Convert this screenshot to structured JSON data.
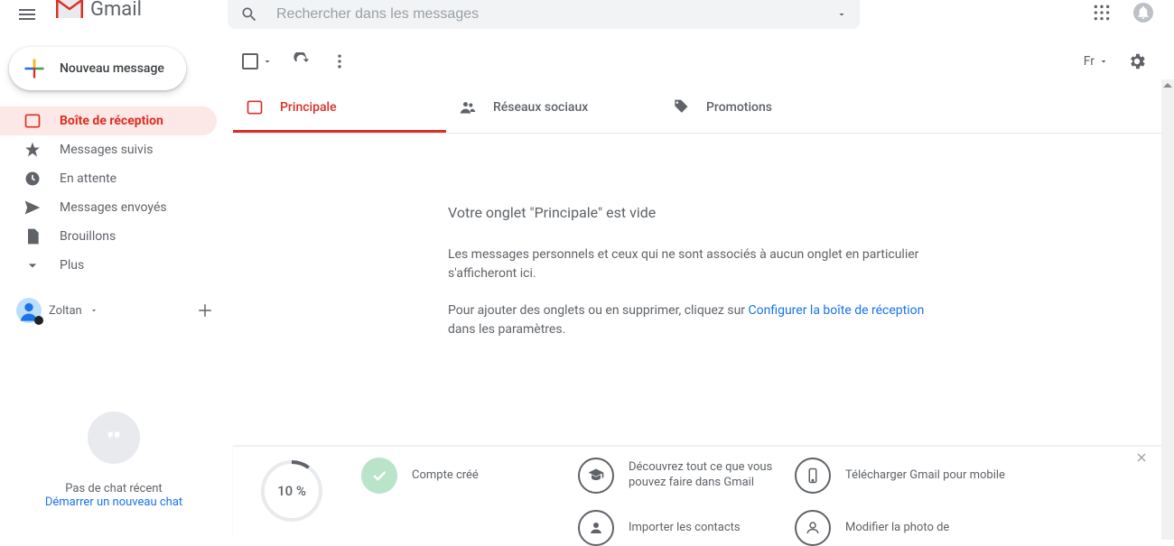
{
  "header": {
    "brand": "Gmail",
    "search_placeholder": "Rechercher dans les messages",
    "language": "Fr"
  },
  "compose": {
    "label": "Nouveau message"
  },
  "nav": {
    "inbox": "Boîte de réception",
    "starred": "Messages suivis",
    "snoozed": "En attente",
    "sent": "Messages envoyés",
    "drafts": "Brouillons",
    "more": "Plus"
  },
  "hangouts": {
    "user_name": "Zoltan",
    "no_chat": "Pas de chat récent",
    "start_chat": "Démarrer un nouveau chat"
  },
  "tabs": {
    "primary": "Principale",
    "social": "Réseaux sociaux",
    "promotions": "Promotions"
  },
  "empty": {
    "title": "Votre onglet \"Principale\" est vide",
    "line1": "Les messages personnels et ceux qui ne sont associés à aucun onglet en particulier s'afficheront ici.",
    "line2a": "Pour ajouter des onglets ou en supprimer, cliquez sur ",
    "config_link": "Configurer la boîte de réception",
    "line2b": " dans les paramètres."
  },
  "onboarding": {
    "percent": "10 %",
    "items": {
      "created": "Compte créé",
      "learn": "Découvrez tout ce que vous pouvez faire dans Gmail",
      "mobile": "Télécharger Gmail pour mobile",
      "import": "Importer les contacts",
      "photo": "Modifier la photo de"
    }
  }
}
